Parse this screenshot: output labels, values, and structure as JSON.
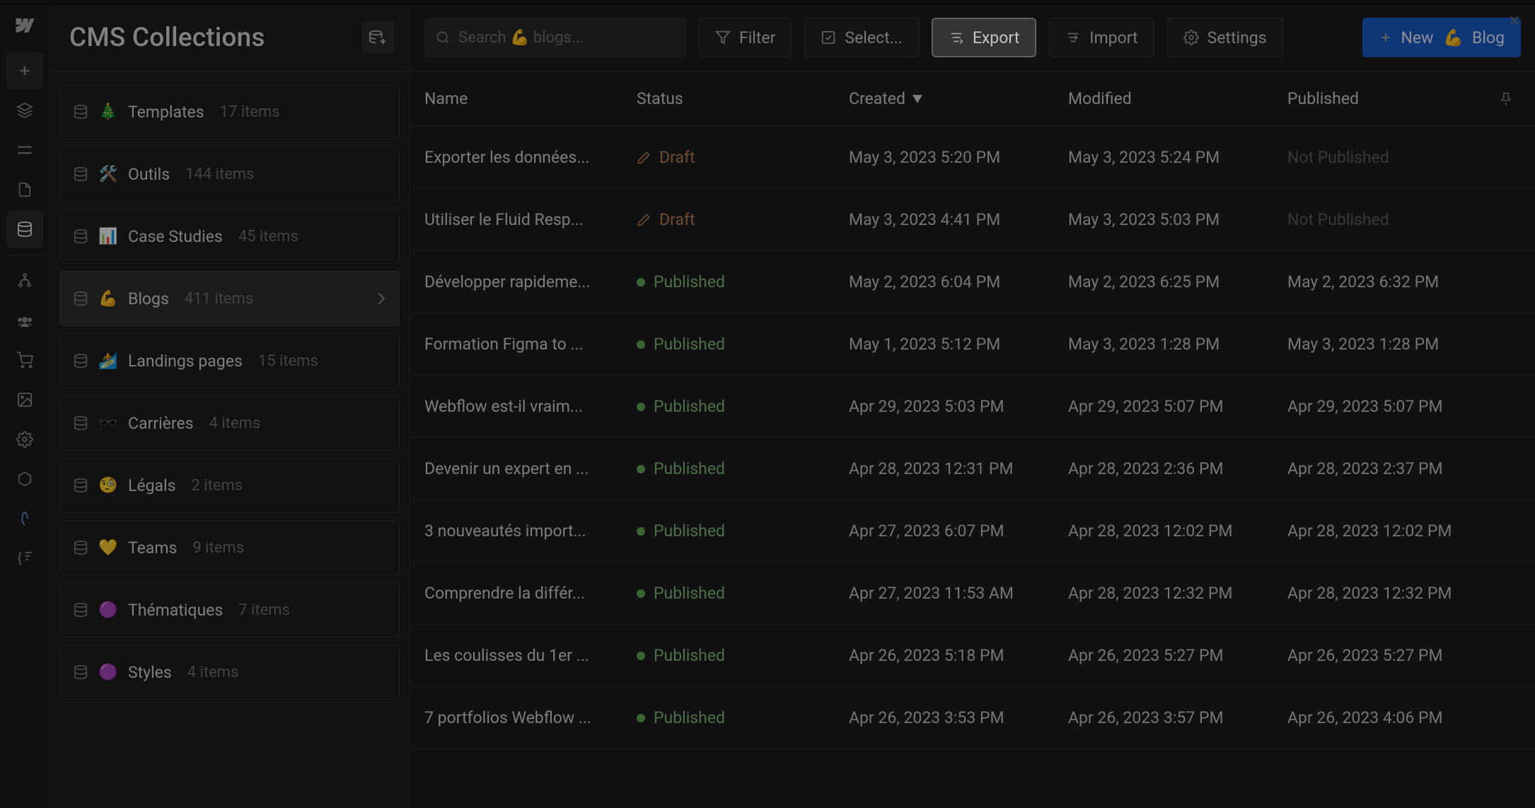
{
  "header": {
    "title": "CMS Collections"
  },
  "search": {
    "placeholder": "Search 💪 blogs..."
  },
  "toolbar": {
    "filter": "Filter",
    "select": "Select...",
    "export": "Export",
    "import": "Import",
    "settings": "Settings",
    "new_prefix": "New",
    "new_emoji": "💪",
    "new_type": "Blog"
  },
  "columns": {
    "name": "Name",
    "status": "Status",
    "created": "Created",
    "modified": "Modified",
    "published": "Published"
  },
  "status_labels": {
    "draft": "Draft",
    "published": "Published",
    "not_published": "Not Published"
  },
  "collections": [
    {
      "emoji": "🎄",
      "name": "Templates",
      "count": "17 items"
    },
    {
      "emoji": "🛠️",
      "name": "Outils",
      "count": "144 items"
    },
    {
      "emoji": "📊",
      "name": "Case Studies",
      "count": "45 items"
    },
    {
      "emoji": "💪",
      "name": "Blogs",
      "count": "411 items",
      "active": true
    },
    {
      "emoji": "🏄",
      "name": "Landings pages",
      "count": "15 items"
    },
    {
      "emoji": "🕶️",
      "name": "Carrières",
      "count": "4 items"
    },
    {
      "emoji": "🧐",
      "name": "Légals",
      "count": "2 items"
    },
    {
      "emoji": "💛",
      "name": "Teams",
      "count": "9 items"
    },
    {
      "emoji": "🟣",
      "name": "Thématiques",
      "count": "7 items"
    },
    {
      "emoji": "🟣",
      "name": "Styles",
      "count": "4 items"
    }
  ],
  "rows": [
    {
      "name": "Exporter les données...",
      "status": "draft",
      "created": "May 3, 2023 5:20 PM",
      "modified": "May 3, 2023 5:24 PM",
      "published": ""
    },
    {
      "name": "Utiliser le Fluid Resp...",
      "status": "draft",
      "created": "May 3, 2023 4:41 PM",
      "modified": "May 3, 2023 5:03 PM",
      "published": ""
    },
    {
      "name": "Développer rapideme...",
      "status": "published",
      "created": "May 2, 2023 6:04 PM",
      "modified": "May 2, 2023 6:25 PM",
      "published": "May 2, 2023 6:32 PM"
    },
    {
      "name": "Formation Figma to ...",
      "status": "published",
      "created": "May 1, 2023 5:12 PM",
      "modified": "May 3, 2023 1:28 PM",
      "published": "May 3, 2023 1:28 PM"
    },
    {
      "name": "Webflow est-il vraim...",
      "status": "published",
      "created": "Apr 29, 2023 5:03 PM",
      "modified": "Apr 29, 2023 5:07 PM",
      "published": "Apr 29, 2023 5:07 PM"
    },
    {
      "name": "Devenir un expert en ...",
      "status": "published",
      "created": "Apr 28, 2023 12:31 PM",
      "modified": "Apr 28, 2023 2:36 PM",
      "published": "Apr 28, 2023 2:37 PM"
    },
    {
      "name": "3 nouveautés import...",
      "status": "published",
      "created": "Apr 27, 2023 6:07 PM",
      "modified": "Apr 28, 2023 12:02 PM",
      "published": "Apr 28, 2023 12:02 PM"
    },
    {
      "name": "Comprendre la différ...",
      "status": "published",
      "created": "Apr 27, 2023 11:53 AM",
      "modified": "Apr 28, 2023 12:32 PM",
      "published": "Apr 28, 2023 12:32 PM"
    },
    {
      "name": "Les coulisses du 1er ...",
      "status": "published",
      "created": "Apr 26, 2023 5:18 PM",
      "modified": "Apr 26, 2023 5:27 PM",
      "published": "Apr 26, 2023 5:27 PM"
    },
    {
      "name": "7 portfolios Webflow ...",
      "status": "published",
      "created": "Apr 26, 2023 3:53 PM",
      "modified": "Apr 26, 2023 3:57 PM",
      "published": "Apr 26, 2023 4:06 PM"
    }
  ]
}
